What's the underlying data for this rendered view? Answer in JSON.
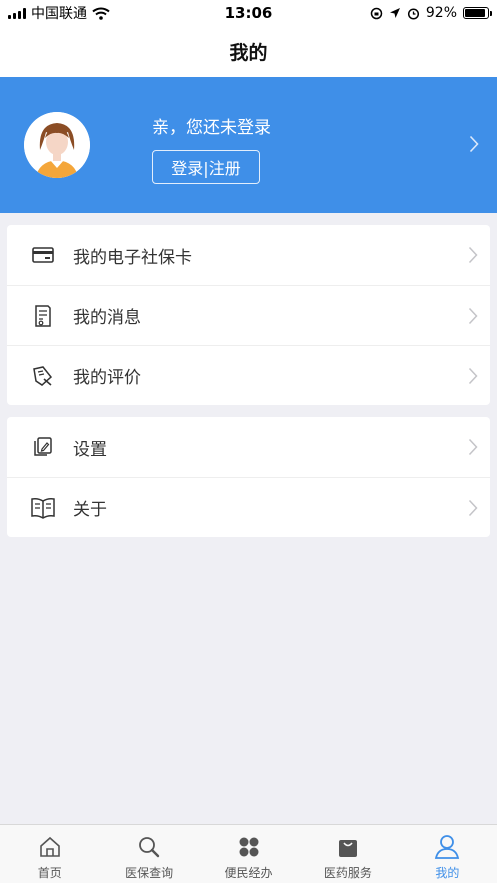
{
  "status_bar": {
    "carrier": "中国联通",
    "time": "13:06",
    "battery_percent": "92%",
    "battery_level": 0.92
  },
  "nav": {
    "title": "我的"
  },
  "profile": {
    "greeting": "亲，您还未登录",
    "login_label": "登录|注册"
  },
  "menu_group_1": [
    {
      "label": "我的电子社保卡",
      "icon": "card-icon"
    },
    {
      "label": "我的消息",
      "icon": "message-icon"
    },
    {
      "label": "我的评价",
      "icon": "review-icon"
    }
  ],
  "menu_group_2": [
    {
      "label": "设置",
      "icon": "settings-icon"
    },
    {
      "label": "关于",
      "icon": "book-icon"
    }
  ],
  "tabs": [
    {
      "label": "首页",
      "icon": "home-icon"
    },
    {
      "label": "医保查询",
      "icon": "search-icon"
    },
    {
      "label": "便民经办",
      "icon": "grid-icon"
    },
    {
      "label": "医药服务",
      "icon": "bag-icon"
    },
    {
      "label": "我的",
      "icon": "person-icon",
      "active": true
    }
  ],
  "colors": {
    "accent": "#3f8fe8",
    "background": "#efeff4"
  }
}
